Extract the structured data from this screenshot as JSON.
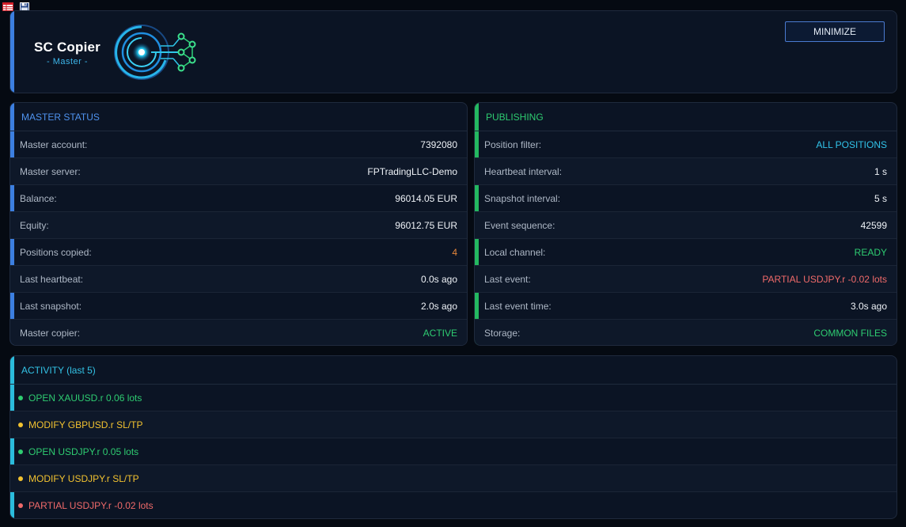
{
  "header": {
    "logo_title": "SC Copier",
    "logo_subtitle": "- Master -",
    "minimize_label": "MINIMIZE"
  },
  "master_status": {
    "title": "MASTER STATUS",
    "rows": [
      {
        "label": "Master account:",
        "value": "7392080"
      },
      {
        "label": "Master server:",
        "value": "FPTradingLLC-Demo"
      },
      {
        "label": "Balance:",
        "value": "96014.05 EUR"
      },
      {
        "label": "Equity:",
        "value": "96012.75 EUR"
      },
      {
        "label": "Positions copied:",
        "value": "4"
      },
      {
        "label": "Last heartbeat:",
        "value": "0.0s ago"
      },
      {
        "label": "Last snapshot:",
        "value": "2.0s ago"
      },
      {
        "label": "Master copier:",
        "value": "ACTIVE"
      }
    ]
  },
  "publishing": {
    "title": "PUBLISHING",
    "rows": [
      {
        "label": "Position filter:",
        "value": "ALL POSITIONS"
      },
      {
        "label": "Heartbeat interval:",
        "value": "1 s"
      },
      {
        "label": "Snapshot interval:",
        "value": "5 s"
      },
      {
        "label": "Event sequence:",
        "value": "42599"
      },
      {
        "label": "Local channel:",
        "value": "READY"
      },
      {
        "label": "Last event:",
        "value": "PARTIAL USDJPY.r -0.02 lots"
      },
      {
        "label": "Last event time:",
        "value": "3.0s ago"
      },
      {
        "label": "Storage:",
        "value": "COMMON FILES"
      }
    ]
  },
  "activity": {
    "title": "ACTIVITY (last 5)",
    "items": [
      {
        "text": "OPEN XAUUSD.r 0.06 lots",
        "status": "green"
      },
      {
        "text": "MODIFY GBPUSD.r SL/TP",
        "status": "yellow"
      },
      {
        "text": "OPEN USDJPY.r 0.05 lots",
        "status": "green"
      },
      {
        "text": "MODIFY USDJPY.r SL/TP",
        "status": "yellow"
      },
      {
        "text": "PARTIAL USDJPY.r -0.02 lots",
        "status": "red"
      }
    ]
  },
  "colors": {
    "accent_blue": "#3c7fe0",
    "accent_green": "#24b860",
    "accent_cyan": "#2bbcdc",
    "value_orange": "#e6863a",
    "value_green": "#2ecc71",
    "value_cyan": "#31c3e9",
    "value_red": "#f06a6a",
    "value_yellow": "#f2c230"
  },
  "icons": [
    "table-icon",
    "save-icon",
    "circuit-logo-icon"
  ]
}
